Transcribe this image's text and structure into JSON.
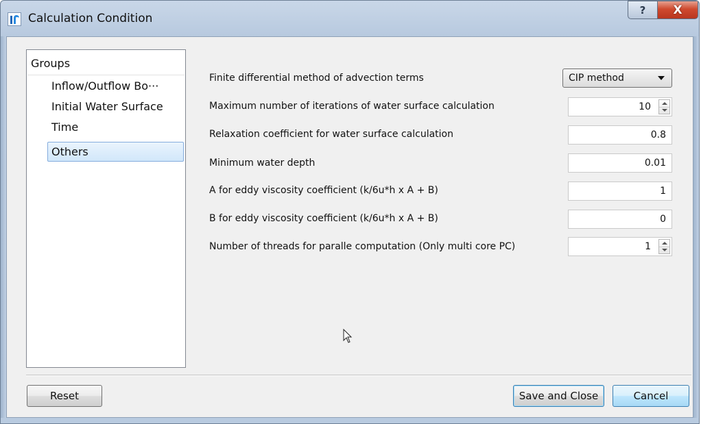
{
  "window": {
    "title": "Calculation Condition",
    "help_glyph": "?",
    "close_glyph": "X"
  },
  "groups": {
    "header": "Groups",
    "items": [
      {
        "label": "Inflow/Outflow Bo···",
        "selected": false
      },
      {
        "label": "Initial Water Surface",
        "selected": false
      },
      {
        "label": "Time",
        "selected": false
      },
      {
        "label": "Others",
        "selected": true
      }
    ]
  },
  "params": [
    {
      "label": "Finite differential method of advection terms",
      "control": "combo",
      "value": "CIP method"
    },
    {
      "label": "Maximum number of iterations of water surface calculation",
      "control": "spin",
      "value": "10"
    },
    {
      "label": "Relaxation coefficient for water surface calculation",
      "control": "field",
      "value": "0.8"
    },
    {
      "label": "Minimum water depth",
      "control": "field",
      "value": "0.01"
    },
    {
      "label": "A for eddy viscosity coefficient (k/6u*h x A + B)",
      "control": "field",
      "value": "1"
    },
    {
      "label": "B for eddy viscosity coefficient (k/6u*h x A + B)",
      "control": "field",
      "value": "0"
    },
    {
      "label": "Number of threads for paralle computation (Only multi core PC)",
      "control": "spin",
      "value": "1"
    }
  ],
  "buttons": {
    "reset": "Reset",
    "save_and_close": "Save and Close",
    "cancel": "Cancel"
  },
  "icons": {
    "app": "iric-app-icon",
    "cursor": "mouse-pointer-icon"
  },
  "colors": {
    "selection_border": "#84acdd",
    "close_button": "#cf4a2f",
    "title_bar": "#c9d7e8"
  }
}
